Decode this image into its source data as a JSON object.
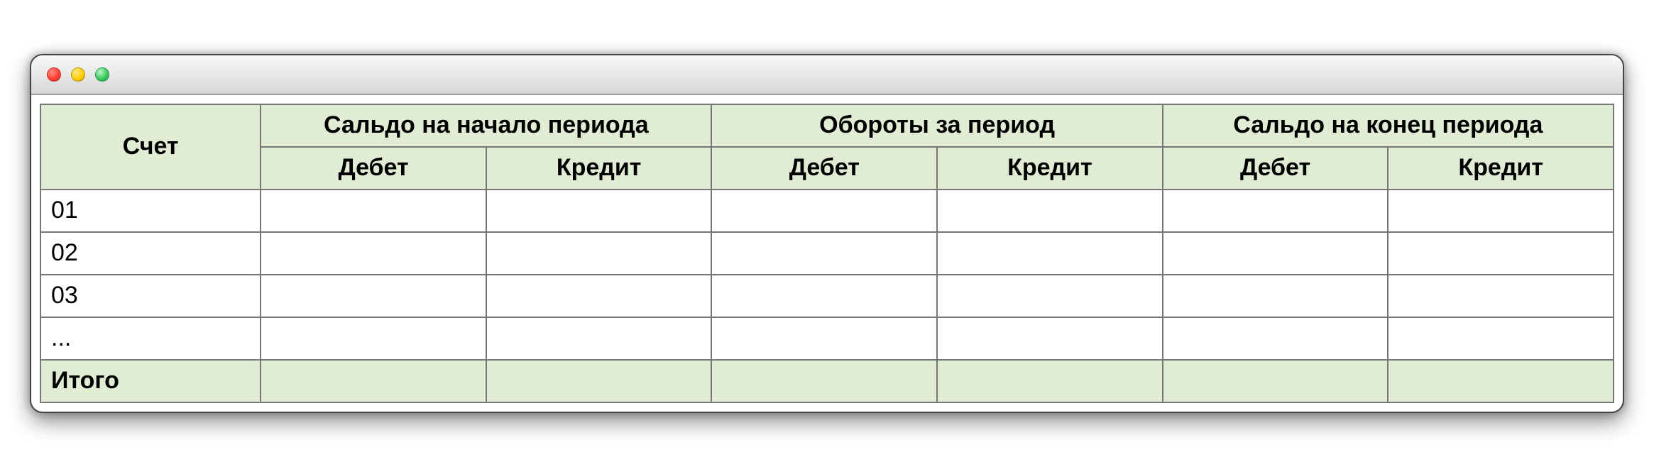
{
  "headers": {
    "account": "Счет",
    "groups": [
      {
        "title": "Сальдо на начало периода",
        "debit": "Дебет",
        "credit": "Кредит"
      },
      {
        "title": "Обороты за период",
        "debit": "Дебет",
        "credit": "Кредит"
      },
      {
        "title": "Сальдо на конец периода",
        "debit": "Дебет",
        "credit": "Кредит"
      }
    ]
  },
  "rows": [
    {
      "account": "01",
      "sb_d": "",
      "sb_c": "",
      "to_d": "",
      "to_c": "",
      "se_d": "",
      "se_c": ""
    },
    {
      "account": "02",
      "sb_d": "",
      "sb_c": "",
      "to_d": "",
      "to_c": "",
      "se_d": "",
      "se_c": ""
    },
    {
      "account": "03",
      "sb_d": "",
      "sb_c": "",
      "to_d": "",
      "to_c": "",
      "se_d": "",
      "se_c": ""
    },
    {
      "account": "...",
      "sb_d": "",
      "sb_c": "",
      "to_d": "",
      "to_c": "",
      "se_d": "",
      "se_c": ""
    }
  ],
  "total": {
    "label": "Итого",
    "sb_d": "",
    "sb_c": "",
    "to_d": "",
    "to_c": "",
    "se_d": "",
    "se_c": ""
  }
}
